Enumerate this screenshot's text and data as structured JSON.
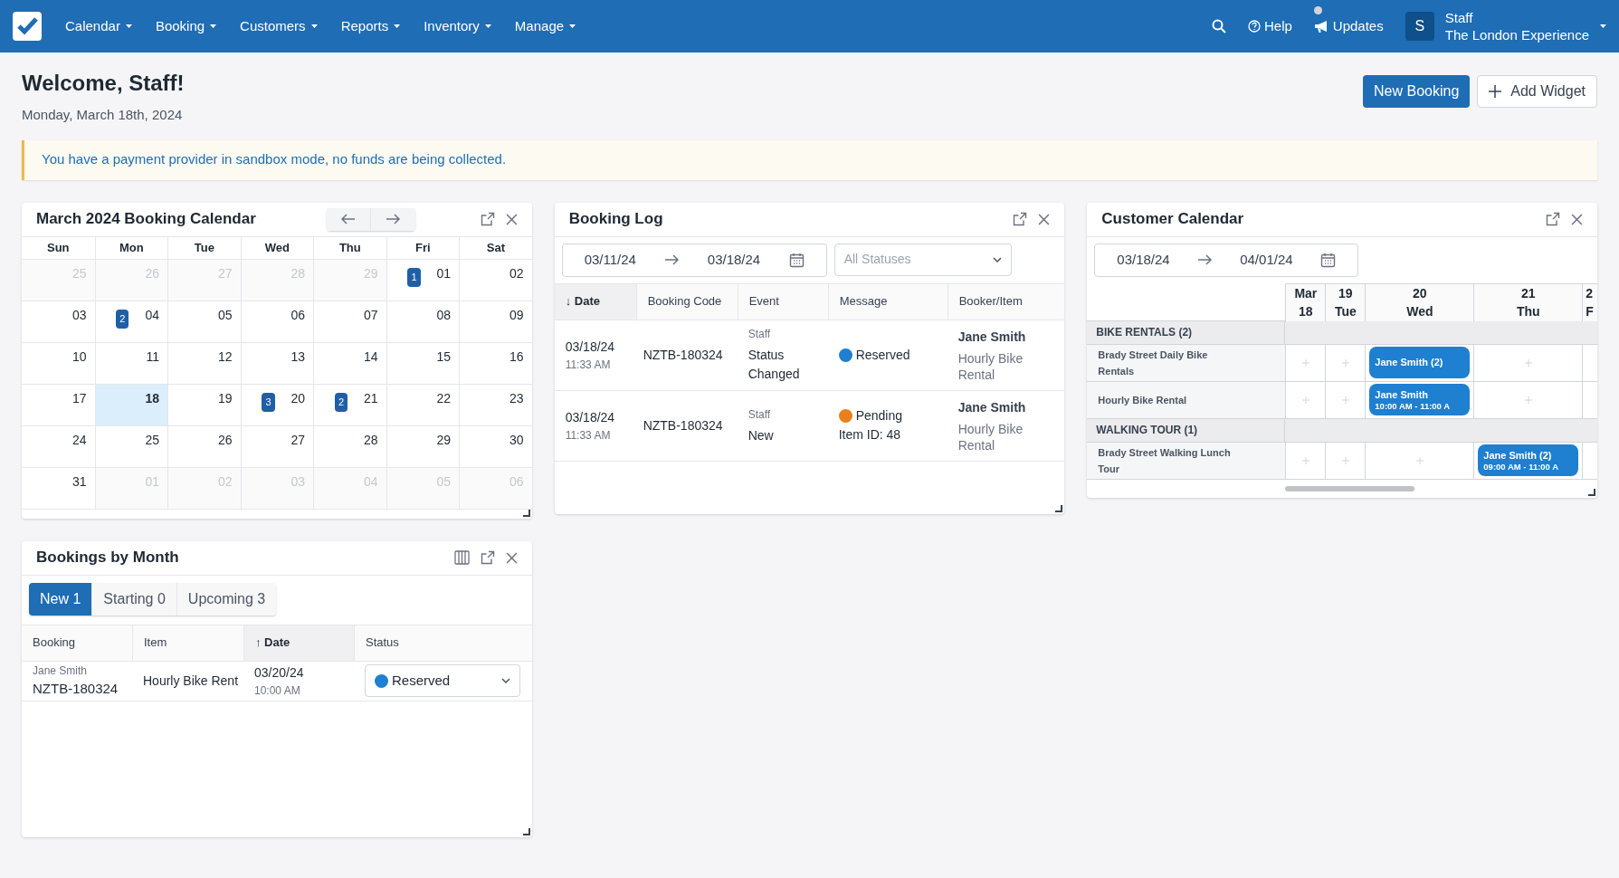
{
  "nav": {
    "menus": [
      "Calendar",
      "Booking",
      "Customers",
      "Reports",
      "Inventory",
      "Manage"
    ],
    "help": "Help",
    "updates": "Updates",
    "updates_unread": true,
    "user": {
      "initial": "S",
      "name": "Staff",
      "org": "The London Experience"
    }
  },
  "header": {
    "title": "Welcome, Staff!",
    "date": "Monday, March 18th, 2024",
    "new_booking": "New Booking",
    "add_widget": "Add Widget"
  },
  "alert": "You have a payment provider in sandbox mode, no funds are being collected.",
  "booking_calendar": {
    "title": "March 2024 Booking Calendar",
    "weekdays": [
      "Sun",
      "Mon",
      "Tue",
      "Wed",
      "Thu",
      "Fri",
      "Sat"
    ],
    "weeks": [
      [
        {
          "day": "25",
          "muted": true,
          "today": false
        },
        {
          "day": "26",
          "muted": true,
          "today": false
        },
        {
          "day": "27",
          "muted": true,
          "today": false
        },
        {
          "day": "28",
          "muted": true,
          "today": false
        },
        {
          "day": "29",
          "muted": true,
          "today": false
        },
        {
          "day": "01",
          "muted": false,
          "today": false,
          "count": "1"
        },
        {
          "day": "02",
          "muted": false,
          "today": false
        }
      ],
      [
        {
          "day": "03",
          "muted": false,
          "today": false
        },
        {
          "day": "04",
          "muted": false,
          "today": false,
          "count": "2"
        },
        {
          "day": "05",
          "muted": false,
          "today": false
        },
        {
          "day": "06",
          "muted": false,
          "today": false
        },
        {
          "day": "07",
          "muted": false,
          "today": false
        },
        {
          "day": "08",
          "muted": false,
          "today": false
        },
        {
          "day": "09",
          "muted": false,
          "today": false
        }
      ],
      [
        {
          "day": "10",
          "muted": false,
          "today": false
        },
        {
          "day": "11",
          "muted": false,
          "today": false
        },
        {
          "day": "12",
          "muted": false,
          "today": false
        },
        {
          "day": "13",
          "muted": false,
          "today": false
        },
        {
          "day": "14",
          "muted": false,
          "today": false
        },
        {
          "day": "15",
          "muted": false,
          "today": false
        },
        {
          "day": "16",
          "muted": false,
          "today": false
        }
      ],
      [
        {
          "day": "17",
          "muted": false,
          "today": false
        },
        {
          "day": "18",
          "muted": false,
          "today": true
        },
        {
          "day": "19",
          "muted": false,
          "today": false
        },
        {
          "day": "20",
          "muted": false,
          "today": false,
          "count": "3"
        },
        {
          "day": "21",
          "muted": false,
          "today": false,
          "count": "2"
        },
        {
          "day": "22",
          "muted": false,
          "today": false
        },
        {
          "day": "23",
          "muted": false,
          "today": false
        }
      ],
      [
        {
          "day": "24",
          "muted": false,
          "today": false
        },
        {
          "day": "25",
          "muted": false,
          "today": false
        },
        {
          "day": "26",
          "muted": false,
          "today": false
        },
        {
          "day": "27",
          "muted": false,
          "today": false
        },
        {
          "day": "28",
          "muted": false,
          "today": false
        },
        {
          "day": "29",
          "muted": false,
          "today": false
        },
        {
          "day": "30",
          "muted": false,
          "today": false
        }
      ],
      [
        {
          "day": "31",
          "muted": false,
          "today": false
        },
        {
          "day": "01",
          "muted": true,
          "today": false
        },
        {
          "day": "02",
          "muted": true,
          "today": false
        },
        {
          "day": "03",
          "muted": true,
          "today": false
        },
        {
          "day": "04",
          "muted": true,
          "today": false
        },
        {
          "day": "05",
          "muted": true,
          "today": false
        },
        {
          "day": "06",
          "muted": true,
          "today": false
        }
      ]
    ]
  },
  "booking_log": {
    "title": "Booking Log",
    "from": "03/11/24",
    "to": "03/18/24",
    "status_filter": "All Statuses",
    "columns": [
      {
        "label": "Date",
        "sorted": true,
        "sort_arrow": "↓"
      },
      {
        "label": "Booking Code",
        "sorted": false
      },
      {
        "label": "Event",
        "sorted": false
      },
      {
        "label": "Message",
        "sorted": false
      },
      {
        "label": "Booker/Item",
        "sorted": false
      }
    ],
    "rows": [
      {
        "date": "03/18/24",
        "time": "11:33 AM",
        "code": "NZTB-180324",
        "actor": "Staff",
        "event": "Status Changed",
        "status": "Reserved",
        "color": "#1f7fd0",
        "booker": "Jane Smith",
        "item": "Hourly Bike Rental"
      },
      {
        "date": "03/18/24",
        "time": "11:33 AM",
        "code": "NZTB-180324",
        "actor": "Staff",
        "event": "New",
        "status": "Pending",
        "color": "#e8801e",
        "detail": "Item ID: 48",
        "booker": "Jane Smith",
        "item": "Hourly Bike Rental"
      }
    ]
  },
  "customer_calendar": {
    "title": "Customer Calendar",
    "from": "03/18/24",
    "to": "04/01/24",
    "columns": [
      {
        "day": "Mar",
        "weekday": "18"
      },
      {
        "day": "19",
        "weekday": "Tue"
      },
      {
        "day": "20",
        "weekday": "Wed"
      },
      {
        "day": "21",
        "weekday": "Thu"
      },
      {
        "day": "2",
        "weekday": "F"
      }
    ],
    "groups": [
      {
        "name": "BIKE RENTALS (2)",
        "items": [
          {
            "name": "Brady Street Daily Bike Rentals",
            "cells": [
              {
                "kind": "empty"
              },
              {
                "kind": "empty"
              },
              {
                "kind": "event",
                "title": "Jane Smith (2)"
              },
              {
                "kind": "empty"
              },
              {
                "kind": "blank"
              }
            ]
          },
          {
            "name": "Hourly Bike Rental",
            "cells": [
              {
                "kind": "empty"
              },
              {
                "kind": "empty"
              },
              {
                "kind": "event",
                "title": "Jane Smith",
                "time": "10:00 AM - 11:00 A"
              },
              {
                "kind": "empty"
              },
              {
                "kind": "blank"
              }
            ]
          }
        ]
      },
      {
        "name": "WALKING TOUR (1)",
        "items": [
          {
            "name": "Brady Street Walking Lunch Tour",
            "cells": [
              {
                "kind": "empty"
              },
              {
                "kind": "empty"
              },
              {
                "kind": "empty"
              },
              {
                "kind": "event",
                "title": "Jane Smith (2)",
                "time": "09:00 AM - 11:00 A"
              },
              {
                "kind": "blank"
              }
            ]
          }
        ]
      }
    ]
  },
  "bookings_by_month": {
    "title": "Bookings by Month",
    "tabs": [
      {
        "label": "New 1",
        "selected": true
      },
      {
        "label": "Starting 0",
        "selected": false
      },
      {
        "label": "Upcoming 3",
        "selected": false
      }
    ],
    "columns": [
      {
        "label": "Booking",
        "sorted": false
      },
      {
        "label": "Item",
        "sorted": false
      },
      {
        "label": "Date",
        "sorted": true,
        "sort_arrow": "↑"
      },
      {
        "label": "Status",
        "sorted": false
      }
    ],
    "rows": [
      {
        "booker": "Jane Smith",
        "code": "NZTB-180324",
        "item": "Hourly Bike Rent",
        "date": "03/20/24",
        "time": "10:00 AM",
        "status": "Reserved",
        "color": "#1f7fd0"
      }
    ]
  }
}
